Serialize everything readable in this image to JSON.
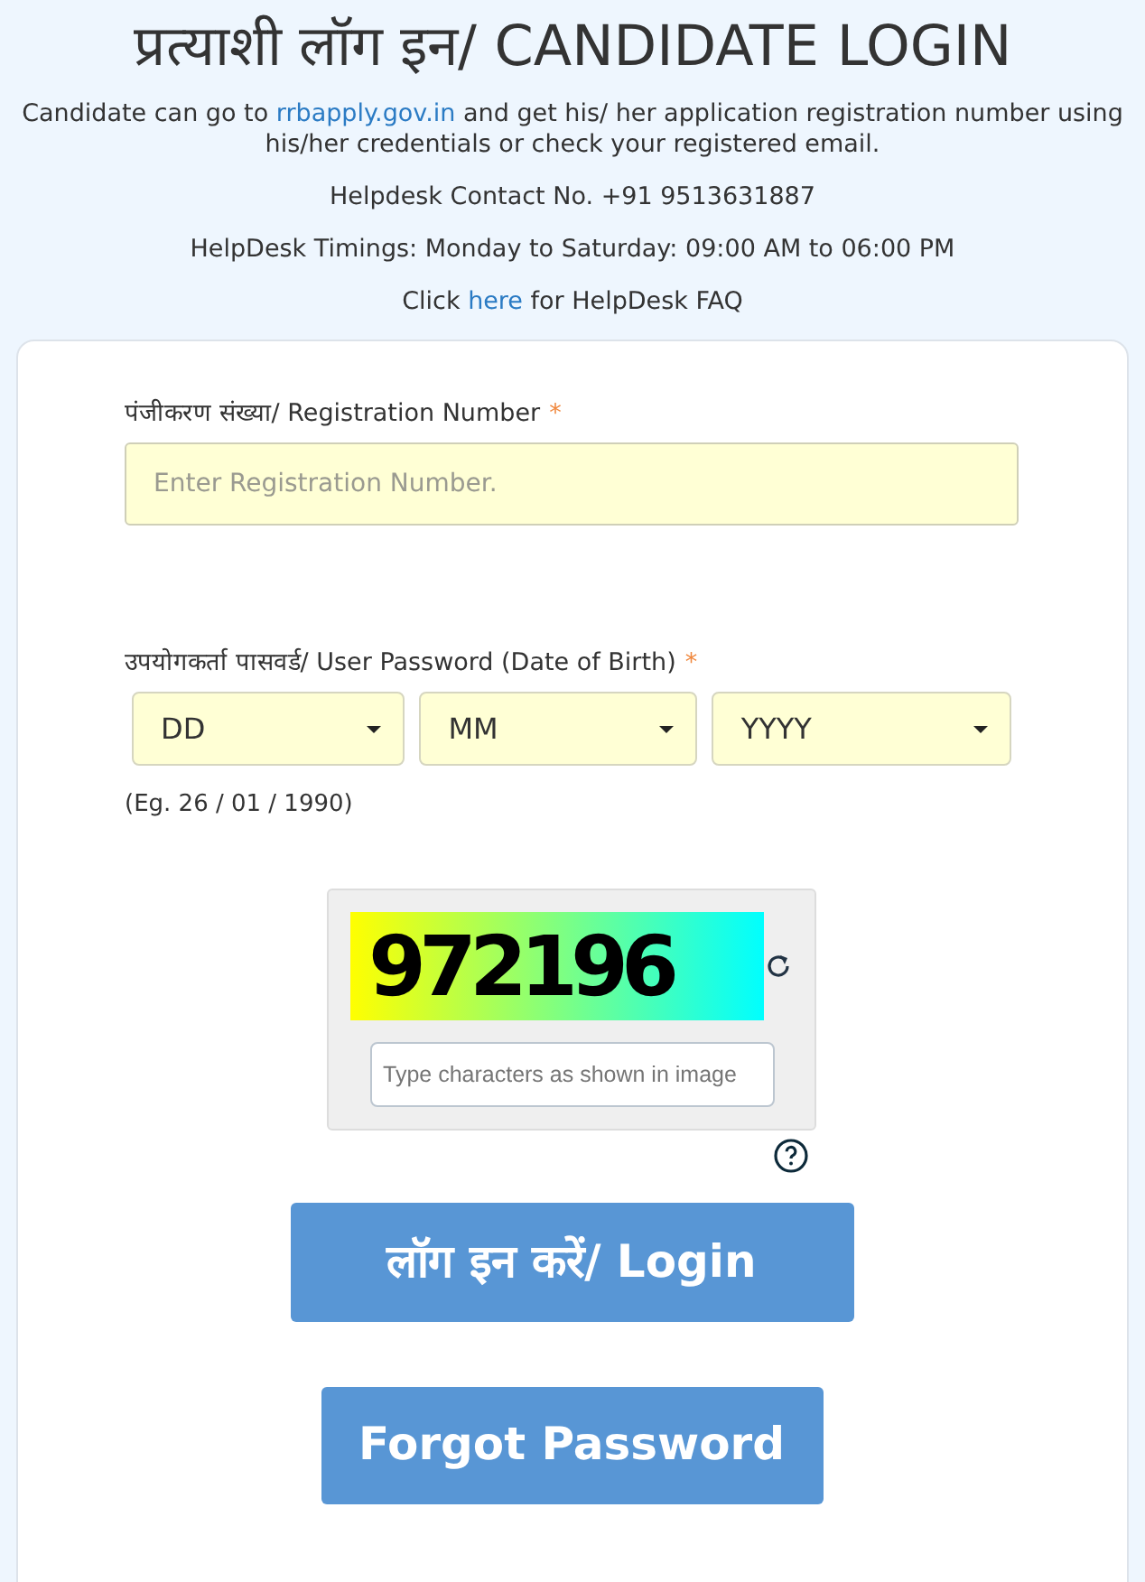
{
  "title": "प्रत्याशी लॉग इन/ CANDIDATE LOGIN",
  "intro": {
    "before": "Candidate can go to ",
    "link": "rrbapply.gov.in",
    "after": " and get his/ her application registration number using his/her credentials or check your registered email."
  },
  "helpdesk_contact": "Helpdesk Contact No. +91 9513631887",
  "helpdesk_timings": "HelpDesk Timings: Monday to Saturday: 09:00 AM to 06:00 PM",
  "faq": {
    "before": "Click ",
    "link": "here",
    "after": " for HelpDesk FAQ"
  },
  "registration": {
    "label": "पंजीकरण संख्या/ Registration Number",
    "required": "*",
    "placeholder": "Enter Registration Number."
  },
  "password": {
    "label": "उपयोगकर्ता पासवर्ड/ User Password (Date of Birth)",
    "required": "*",
    "selects": [
      {
        "value": "DD"
      },
      {
        "value": "MM"
      },
      {
        "value": "YYYY"
      }
    ],
    "example": "(Eg. 26 / 01 / 1990)"
  },
  "captcha": {
    "code": "972196",
    "placeholder": "Type characters as shown in image"
  },
  "login_button": "लॉग इन करें/ Login",
  "forgot_button": "Forgot Password"
}
